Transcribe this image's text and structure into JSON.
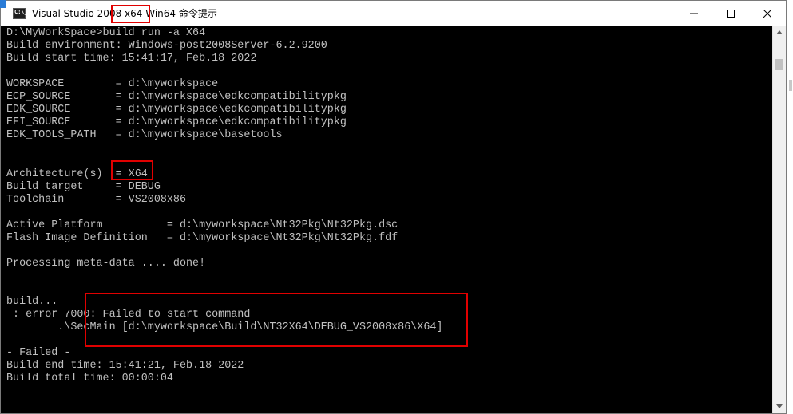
{
  "window": {
    "title": "Visual Studio 2008 x64 Win64 命令提示",
    "icon": "console-icon",
    "icon_text": "C:\\_"
  },
  "console": {
    "lines": [
      "D:\\MyWorkSpace>build run -a X64",
      "Build environment: Windows-post2008Server-6.2.9200",
      "Build start time: 15:41:17, Feb.18 2022",
      "",
      "WORKSPACE        = d:\\myworkspace",
      "ECP_SOURCE       = d:\\myworkspace\\edkcompatibilitypkg",
      "EDK_SOURCE       = d:\\myworkspace\\edkcompatibilitypkg",
      "EFI_SOURCE       = d:\\myworkspace\\edkcompatibilitypkg",
      "EDK_TOOLS_PATH   = d:\\myworkspace\\basetools",
      "",
      "",
      "Architecture(s)  = X64",
      "Build target     = DEBUG",
      "Toolchain        = VS2008x86",
      "",
      "Active Platform          = d:\\myworkspace\\Nt32Pkg\\Nt32Pkg.dsc",
      "Flash Image Definition   = d:\\myworkspace\\Nt32Pkg\\Nt32Pkg.fdf",
      "",
      "Processing meta-data .... done!",
      "",
      "",
      "build...",
      " : error 7000: Failed to start command",
      "        .\\SecMain [d:\\myworkspace\\Build\\NT32X64\\DEBUG_VS2008x86\\X64]",
      "",
      "- Failed -",
      "Build end time: 15:41:21, Feb.18 2022",
      "Build total time: 00:00:04"
    ]
  },
  "colors": {
    "console_bg": "#000000",
    "console_text": "#c0c0c0",
    "highlight": "#e00000"
  },
  "icons": {
    "minimize": "minimize-icon",
    "maximize": "maximize-icon",
    "close": "close-icon",
    "scroll_up": "scroll-up-arrow-icon",
    "scroll_down": "scroll-down-arrow-icon"
  }
}
